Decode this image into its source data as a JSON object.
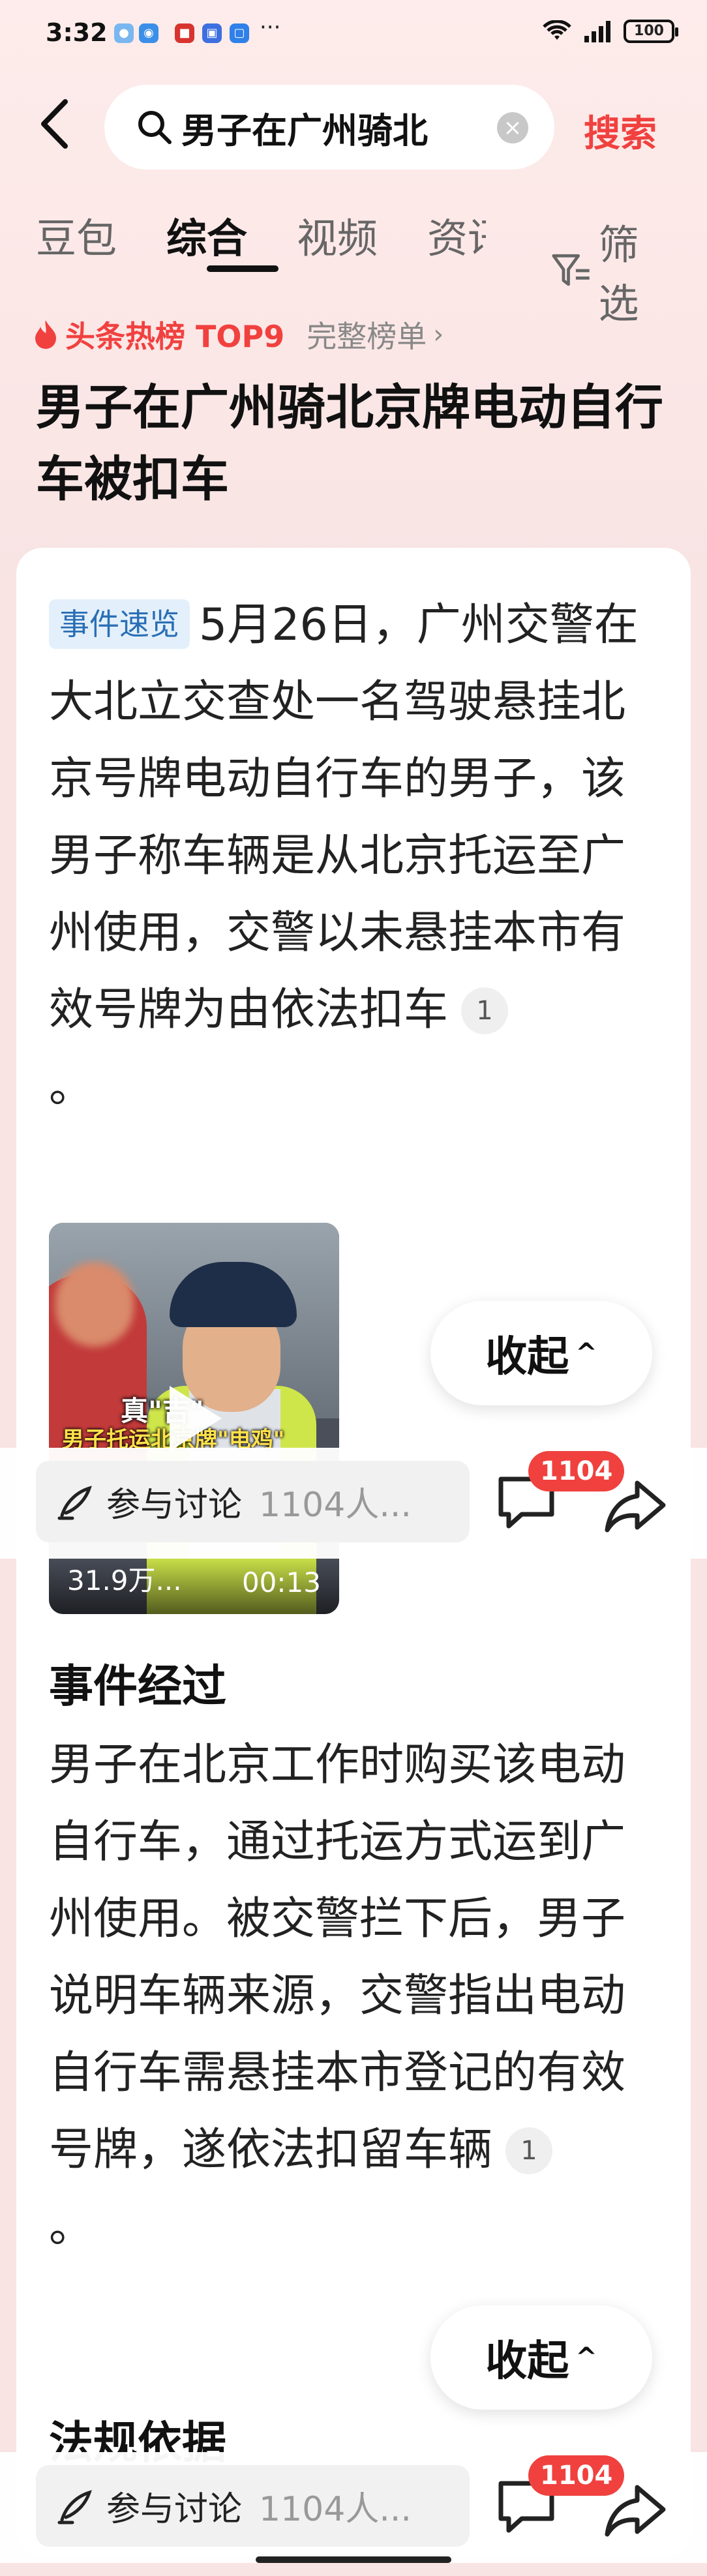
{
  "status_bar": {
    "time": "3:32",
    "dots": "···",
    "battery": "100"
  },
  "search": {
    "query": "男子在广州骑北",
    "submit_label": "搜索"
  },
  "tabs": [
    {
      "label": "豆包"
    },
    {
      "label": "综合"
    },
    {
      "label": "视频"
    },
    {
      "label": "资讯"
    }
  ],
  "filter_label": "筛选",
  "hot_list": {
    "label": "头条热榜 TOP9",
    "full_label": "完整榜单"
  },
  "article": {
    "title": "男子在广州骑北京牌电动自行车被扣车",
    "summary_tag": "事件速览",
    "summary_text": "5月26日，广州交警在大北立交查处一名驾驶悬挂北京号牌电动自行车的男子，该男子称车辆是从北京托运至广州使用，交警以未悬挂本市有效号牌为由依法扣车",
    "summary_cite": "1",
    "summary_end": "。",
    "video": {
      "caption_top": "真\"吉\"",
      "caption_bottom": "男子托运北京牌\"电鸡\"",
      "views": "31.9万...",
      "duration": "00:13"
    },
    "section1_title": "事件经过",
    "section1_text": "男子在北京工作时购买该电动自行车，通过托运方式运到广州使用。被交警拦下后，男子说明车辆来源，交警指出电动自行车需悬挂本市登记的有效号牌，遂依法扣留车辆",
    "section1_cite": "1",
    "section1_end": "。",
    "section2_title": "法规依据"
  },
  "collapse_label": "收起",
  "discussion": {
    "label": "参与讨论",
    "participants": "1104人...",
    "comment_badge": "1104"
  },
  "colors": {
    "accent": "#f0413f",
    "tag_bg": "#e3f0fb",
    "tag_text": "#2a6fb5"
  }
}
